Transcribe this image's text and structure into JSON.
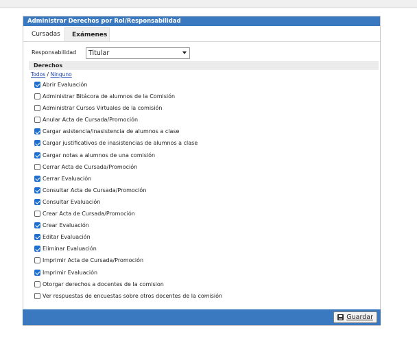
{
  "panel": {
    "title": "Administrar Derechos por Rol/Responsabilidad"
  },
  "tabs": [
    {
      "label": "Cursadas",
      "active": true
    },
    {
      "label": "Exámenes",
      "active": false
    }
  ],
  "responsabilidad": {
    "label": "Responsabilidad",
    "selected": "Titular"
  },
  "derechos": {
    "header": "Derechos",
    "select_all": "Todos",
    "separator": "/",
    "select_none": "Ninguno",
    "items": [
      {
        "label": "Abrir Evaluación",
        "checked": true
      },
      {
        "label": "Administrar Bitácora de alumnos de la Comisión",
        "checked": false
      },
      {
        "label": "Administrar Cursos Virtuales de la comisión",
        "checked": false
      },
      {
        "label": "Anular Acta de Cursada/Promoción",
        "checked": false
      },
      {
        "label": "Cargar asistencia/inasistencia de alumnos a clase",
        "checked": true
      },
      {
        "label": "Cargar justificativos de inasistencias de alumnos a clase",
        "checked": true
      },
      {
        "label": "Cargar notas a alumnos de una comisión",
        "checked": true
      },
      {
        "label": "Cerrar Acta de Cursada/Promoción",
        "checked": false
      },
      {
        "label": "Cerrar Evaluación",
        "checked": true
      },
      {
        "label": "Consultar Acta de Cursada/Promoción",
        "checked": true
      },
      {
        "label": "Consultar Evaluación",
        "checked": true
      },
      {
        "label": "Crear Acta de Cursada/Promoción",
        "checked": false
      },
      {
        "label": "Crear Evaluación",
        "checked": true
      },
      {
        "label": "Editar Evaluación",
        "checked": true
      },
      {
        "label": "Eliminar Evaluación",
        "checked": true
      },
      {
        "label": "Imprimir Acta de Cursada/Promoción",
        "checked": false
      },
      {
        "label": "Imprimir Evaluación",
        "checked": true
      },
      {
        "label": "Otorgar derechos a docentes de la comision",
        "checked": false
      },
      {
        "label": "Ver respuestas de encuestas sobre otros docentes de la comisión",
        "checked": false
      }
    ]
  },
  "footer": {
    "save_label": "Guardar",
    "save_icon": "floppy-disk-icon"
  },
  "colors": {
    "header_blue": "#3a78c0",
    "checkbox_blue": "#1f6fd0"
  }
}
